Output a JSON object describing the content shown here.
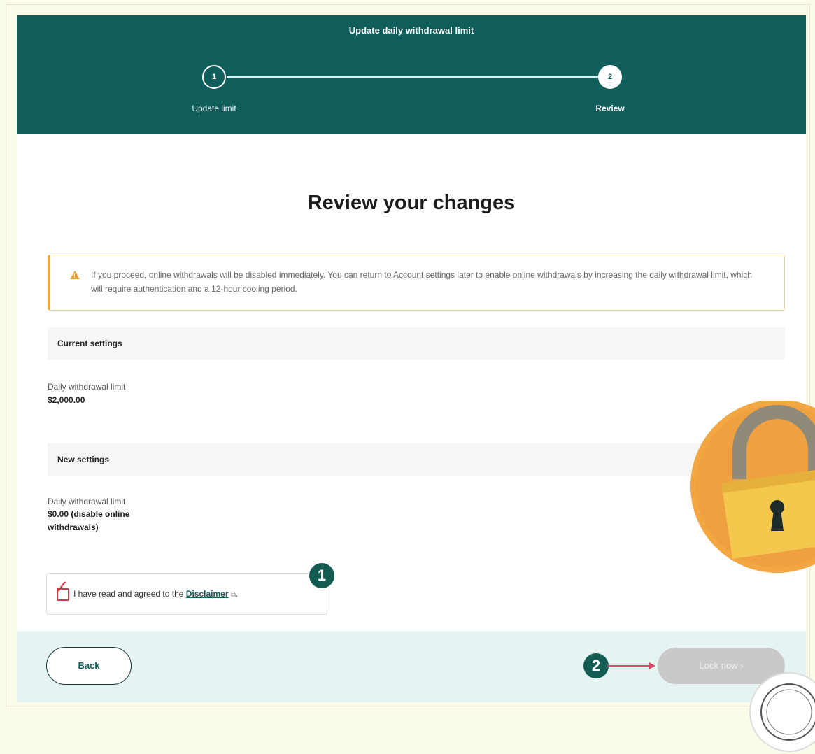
{
  "header": {
    "title": "Update daily withdrawal limit",
    "steps": [
      {
        "number": "1",
        "label": "Update limit"
      },
      {
        "number": "2",
        "label": "Review"
      }
    ]
  },
  "main": {
    "title": "Review your changes",
    "warning": "If you proceed, online withdrawals will be disabled immediately. You can return to Account settings later to enable online withdrawals by increasing the daily withdrawal limit, which will require authentication and a 12-hour cooling period.",
    "current": {
      "heading": "Current settings",
      "label": "Daily withdrawal limit",
      "value": "$2,000.00"
    },
    "new": {
      "heading": "New settings",
      "label": "Daily withdrawal limit",
      "value": "$0.00 (disable online withdrawals)"
    },
    "disclaimer": {
      "prefix": "I have read and agreed to the",
      "link": "Disclaimer",
      "suffix": ".",
      "checked": true
    }
  },
  "annotations": [
    "1",
    "2"
  ],
  "footer": {
    "back_label": "Back",
    "lock_label": "Lock now  ›"
  },
  "icons": {
    "warning": "warning-triangle-icon",
    "external": "external-link-icon",
    "lock": "padlock-icon"
  },
  "colors": {
    "header_bg": "#0f5e5b",
    "warning_accent": "#f0a830",
    "annotation": "#135a52",
    "check": "#d83a4a",
    "disabled_button": "#c9c9c9"
  }
}
